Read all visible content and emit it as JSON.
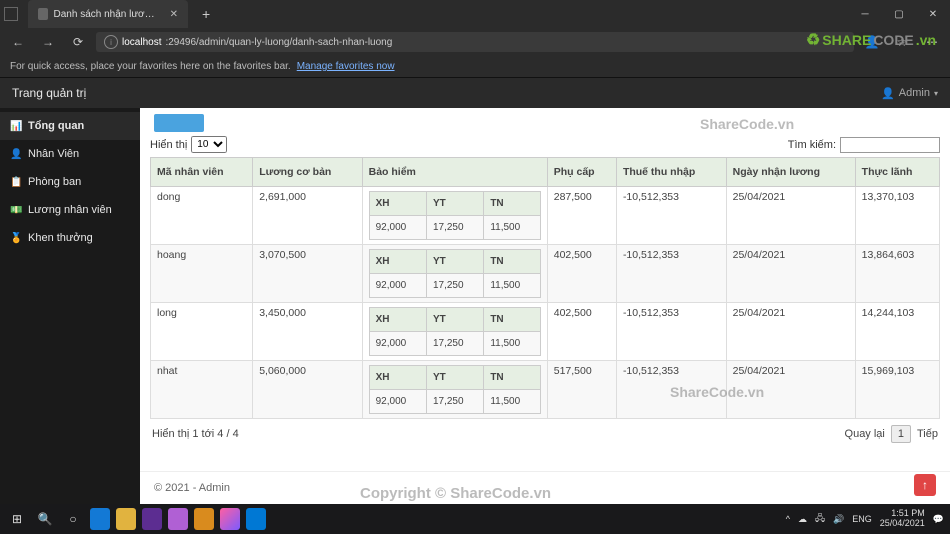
{
  "browser": {
    "tab_title": "Danh sách nhận lương-Admin",
    "url_host": "localhost",
    "url_path": ":29496/admin/quan-ly-luong/danh-sach-nhan-luong",
    "fav_prompt": "For quick access, place your favorites here on the favorites bar.",
    "fav_link": "Manage favorites now"
  },
  "app": {
    "brand": "Trang quản trị",
    "user_label": "Admin"
  },
  "sidebar": {
    "items": [
      {
        "icon": "📊",
        "label": "Tổng quan",
        "active": true
      },
      {
        "icon": "👤",
        "label": "Nhân Viên",
        "active": false
      },
      {
        "icon": "📋",
        "label": "Phòng ban",
        "active": false
      },
      {
        "icon": "💵",
        "label": "Lương nhân viên",
        "active": false
      },
      {
        "icon": "🏅",
        "label": "Khen thưởng",
        "active": false
      }
    ]
  },
  "table": {
    "show_label_prefix": "Hiển thị",
    "show_value": "10",
    "search_label": "Tìm kiếm:",
    "columns": [
      "Mã nhân viên",
      "Lương cơ bản",
      "Bảo hiểm",
      "Phụ cấp",
      "Thuế thu nhập",
      "Ngày nhận lương",
      "Thực lãnh"
    ],
    "insurance_cols": [
      "XH",
      "YT",
      "TN"
    ],
    "rows": [
      {
        "ma": "dong",
        "luong": "2,691,000",
        "bh": [
          "92,000",
          "17,250",
          "11,500"
        ],
        "phucap": "287,500",
        "thue": "-10,512,353",
        "ngay": "25/04/2021",
        "thuclanh": "13,370,103"
      },
      {
        "ma": "hoang",
        "luong": "3,070,500",
        "bh": [
          "92,000",
          "17,250",
          "11,500"
        ],
        "phucap": "402,500",
        "thue": "-10,512,353",
        "ngay": "25/04/2021",
        "thuclanh": "13,864,603"
      },
      {
        "ma": "long",
        "luong": "3,450,000",
        "bh": [
          "92,000",
          "17,250",
          "11,500"
        ],
        "phucap": "402,500",
        "thue": "-10,512,353",
        "ngay": "25/04/2021",
        "thuclanh": "14,244,103"
      },
      {
        "ma": "nhat",
        "luong": "5,060,000",
        "bh": [
          "92,000",
          "17,250",
          "11,500"
        ],
        "phucap": "517,500",
        "thue": "-10,512,353",
        "ngay": "25/04/2021",
        "thuclanh": "15,969,103"
      }
    ],
    "info": "Hiển thị 1 tới 4 / 4",
    "prev": "Quay lại",
    "page": "1",
    "next": "Tiếp"
  },
  "footer": "© 2021 - Admin",
  "fab": "↑",
  "wm_center": "Copyright © ShareCode.vn",
  "wm_tr": "ShareCode.vn",
  "wm_br": "ShareCode.vn",
  "logo_brand": "SHARE",
  "logo_brand2": "CODE",
  "logo_suffix": ".vn",
  "taskbar": {
    "lang": "ENG",
    "time": "1:51 PM",
    "date": "25/04/2021"
  }
}
